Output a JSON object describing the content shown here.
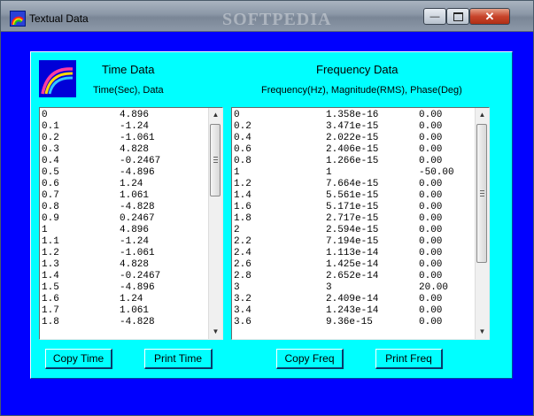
{
  "window": {
    "title": "Textual Data",
    "watermark": "SOFTPEDIA"
  },
  "time": {
    "header": "Time Data",
    "subheader": "Time(Sec),  Data",
    "rows": [
      [
        "0",
        "4.896"
      ],
      [
        "0.1",
        "-1.24"
      ],
      [
        "0.2",
        "-1.061"
      ],
      [
        "0.3",
        "4.828"
      ],
      [
        "0.4",
        "-0.2467"
      ],
      [
        "0.5",
        "-4.896"
      ],
      [
        "0.6",
        "1.24"
      ],
      [
        "0.7",
        "1.061"
      ],
      [
        "0.8",
        "-4.828"
      ],
      [
        "0.9",
        "0.2467"
      ],
      [
        "1",
        "4.896"
      ],
      [
        "1.1",
        "-1.24"
      ],
      [
        "1.2",
        "-1.061"
      ],
      [
        "1.3",
        "4.828"
      ],
      [
        "1.4",
        "-0.2467"
      ],
      [
        "1.5",
        "-4.896"
      ],
      [
        "1.6",
        "1.24"
      ],
      [
        "1.7",
        "1.061"
      ],
      [
        "1.8",
        "-4.828"
      ]
    ]
  },
  "freq": {
    "header": "Frequency Data",
    "subheader": "Frequency(Hz),  Magnitude(RMS),  Phase(Deg)",
    "rows": [
      [
        "0",
        "1.358e-16",
        "0.00"
      ],
      [
        "0.2",
        "3.471e-15",
        "0.00"
      ],
      [
        "0.4",
        "2.022e-15",
        "0.00"
      ],
      [
        "0.6",
        "2.406e-15",
        "0.00"
      ],
      [
        "0.8",
        "1.266e-15",
        "0.00"
      ],
      [
        "1",
        "1",
        "-50.00"
      ],
      [
        "1.2",
        "7.664e-15",
        "0.00"
      ],
      [
        "1.4",
        "5.561e-15",
        "0.00"
      ],
      [
        "1.6",
        "5.171e-15",
        "0.00"
      ],
      [
        "1.8",
        "2.717e-15",
        "0.00"
      ],
      [
        "2",
        "2.594e-15",
        "0.00"
      ],
      [
        "2.2",
        "7.194e-15",
        "0.00"
      ],
      [
        "2.4",
        "1.113e-14",
        "0.00"
      ],
      [
        "2.6",
        "1.425e-14",
        "0.00"
      ],
      [
        "2.8",
        "2.652e-14",
        "0.00"
      ],
      [
        "3",
        "3",
        "20.00"
      ],
      [
        "3.2",
        "2.409e-14",
        "0.00"
      ],
      [
        "3.4",
        "1.243e-14",
        "0.00"
      ],
      [
        "3.6",
        "9.36e-15",
        "0.00"
      ]
    ]
  },
  "buttons": {
    "copy_time": "Copy Time",
    "print_time": "Print Time",
    "copy_freq": "Copy Freq",
    "print_freq": "Print Freq"
  },
  "colors": {
    "panel": "#00ffff",
    "frame": "#0000ff",
    "logo_bg": "#0000d8"
  }
}
